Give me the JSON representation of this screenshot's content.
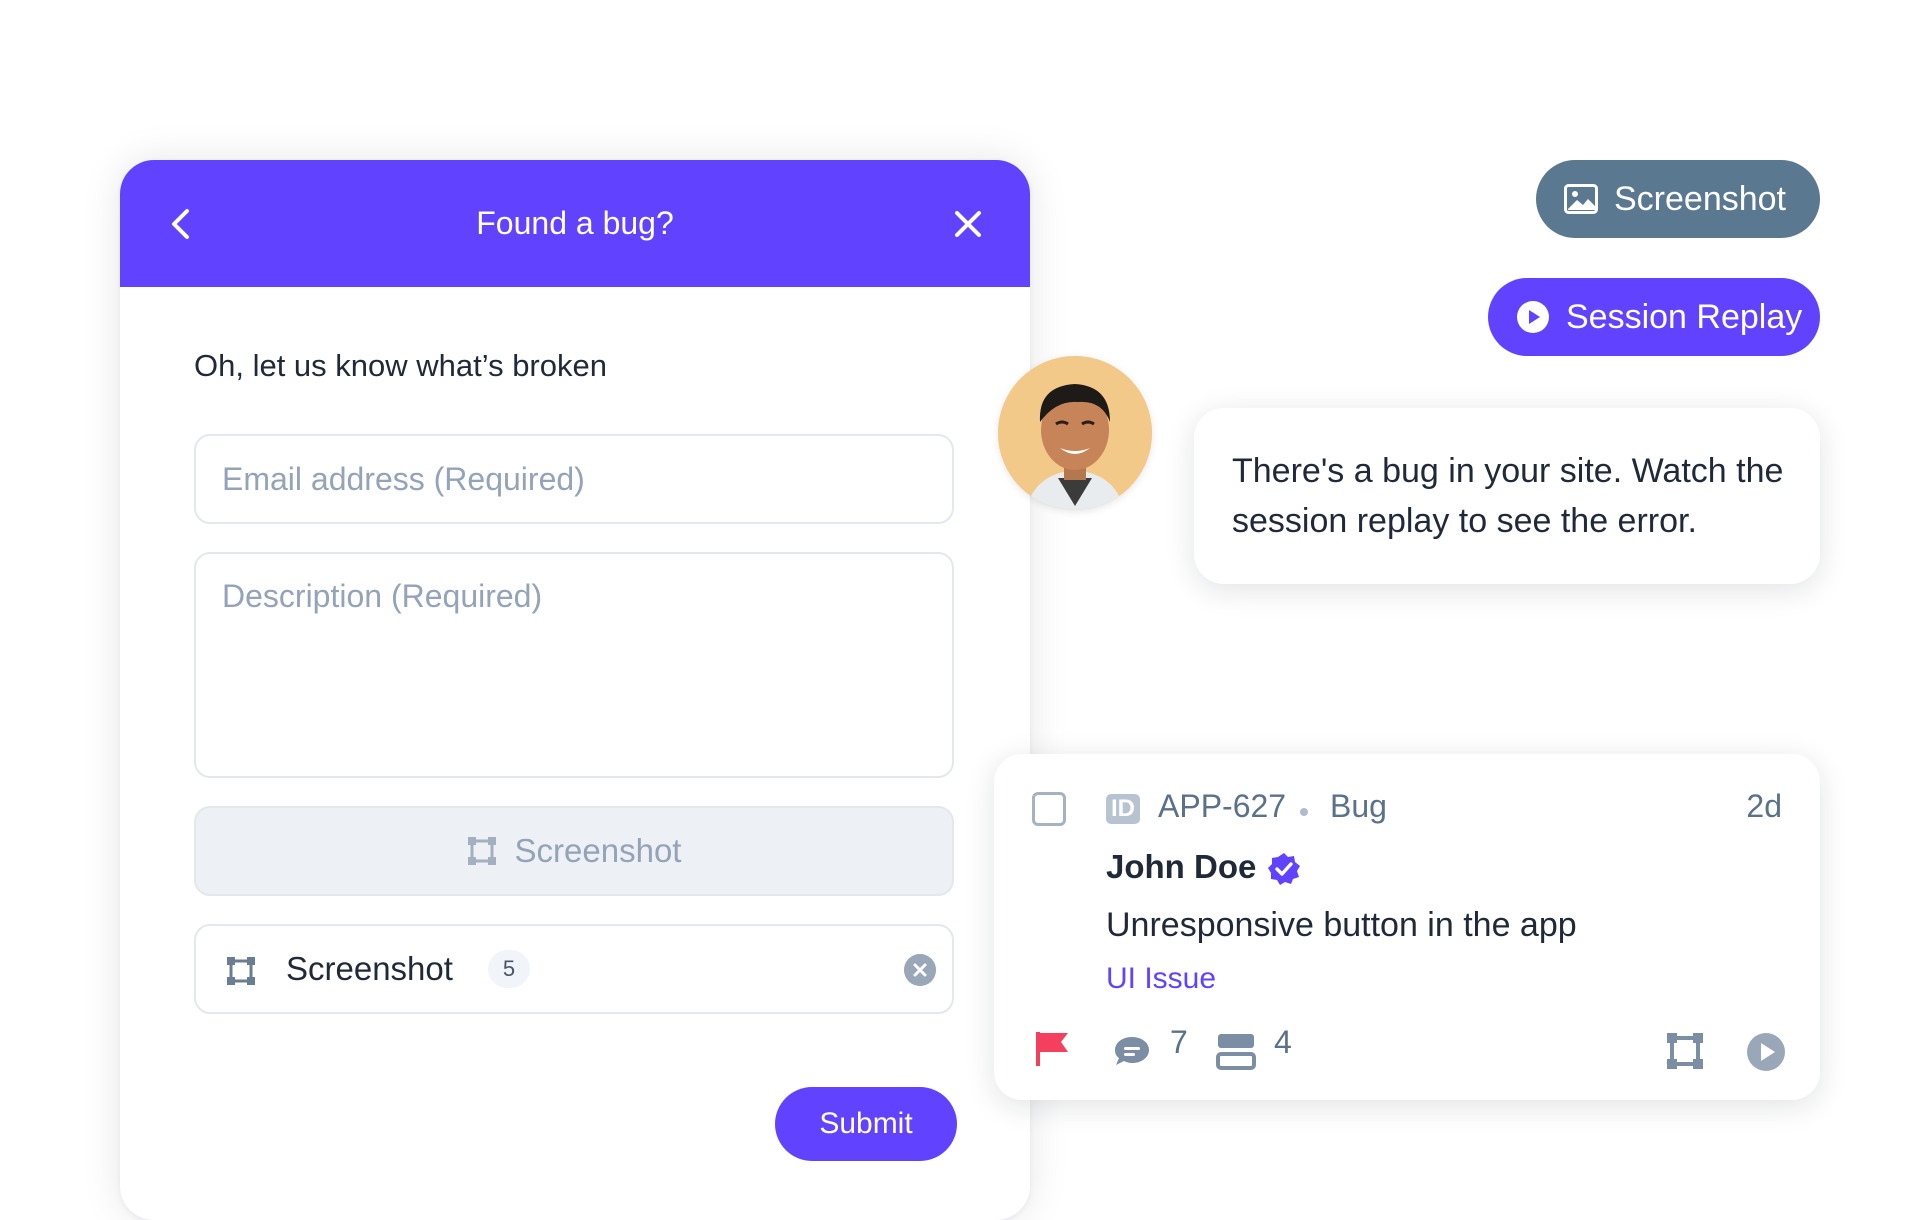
{
  "widget": {
    "title": "Found a bug?",
    "prompt": "Oh, let us know what’s broken",
    "email_placeholder": "Email address (Required)",
    "description_placeholder": "Description (Required)",
    "screenshot_button_label": "Screenshot",
    "attachment": {
      "label": "Screenshot",
      "count": "5"
    },
    "submit_label": "Submit"
  },
  "pills": {
    "screenshot": "Screenshot",
    "session_replay": "Session Replay"
  },
  "message": {
    "text": "There's a bug in your site. Watch the session replay to see the error."
  },
  "report": {
    "id_badge": "ID",
    "id": "APP-627",
    "type": "Bug",
    "age": "2d",
    "reporter": "John Doe",
    "summary": "Unresponsive button in the app",
    "label": "UI Issue",
    "comments": "7",
    "stack": "4"
  },
  "colors": {
    "brand": "#6142FF",
    "slate_pill": "#5b7891",
    "flag": "#f43f5e",
    "muted_text": "#5b7189"
  },
  "icons": [
    "back-arrow-icon",
    "close-icon",
    "image-icon",
    "play-icon",
    "crop-icon",
    "clear-icon",
    "verified-icon",
    "flag-icon",
    "comment-icon",
    "stack-icon"
  ]
}
